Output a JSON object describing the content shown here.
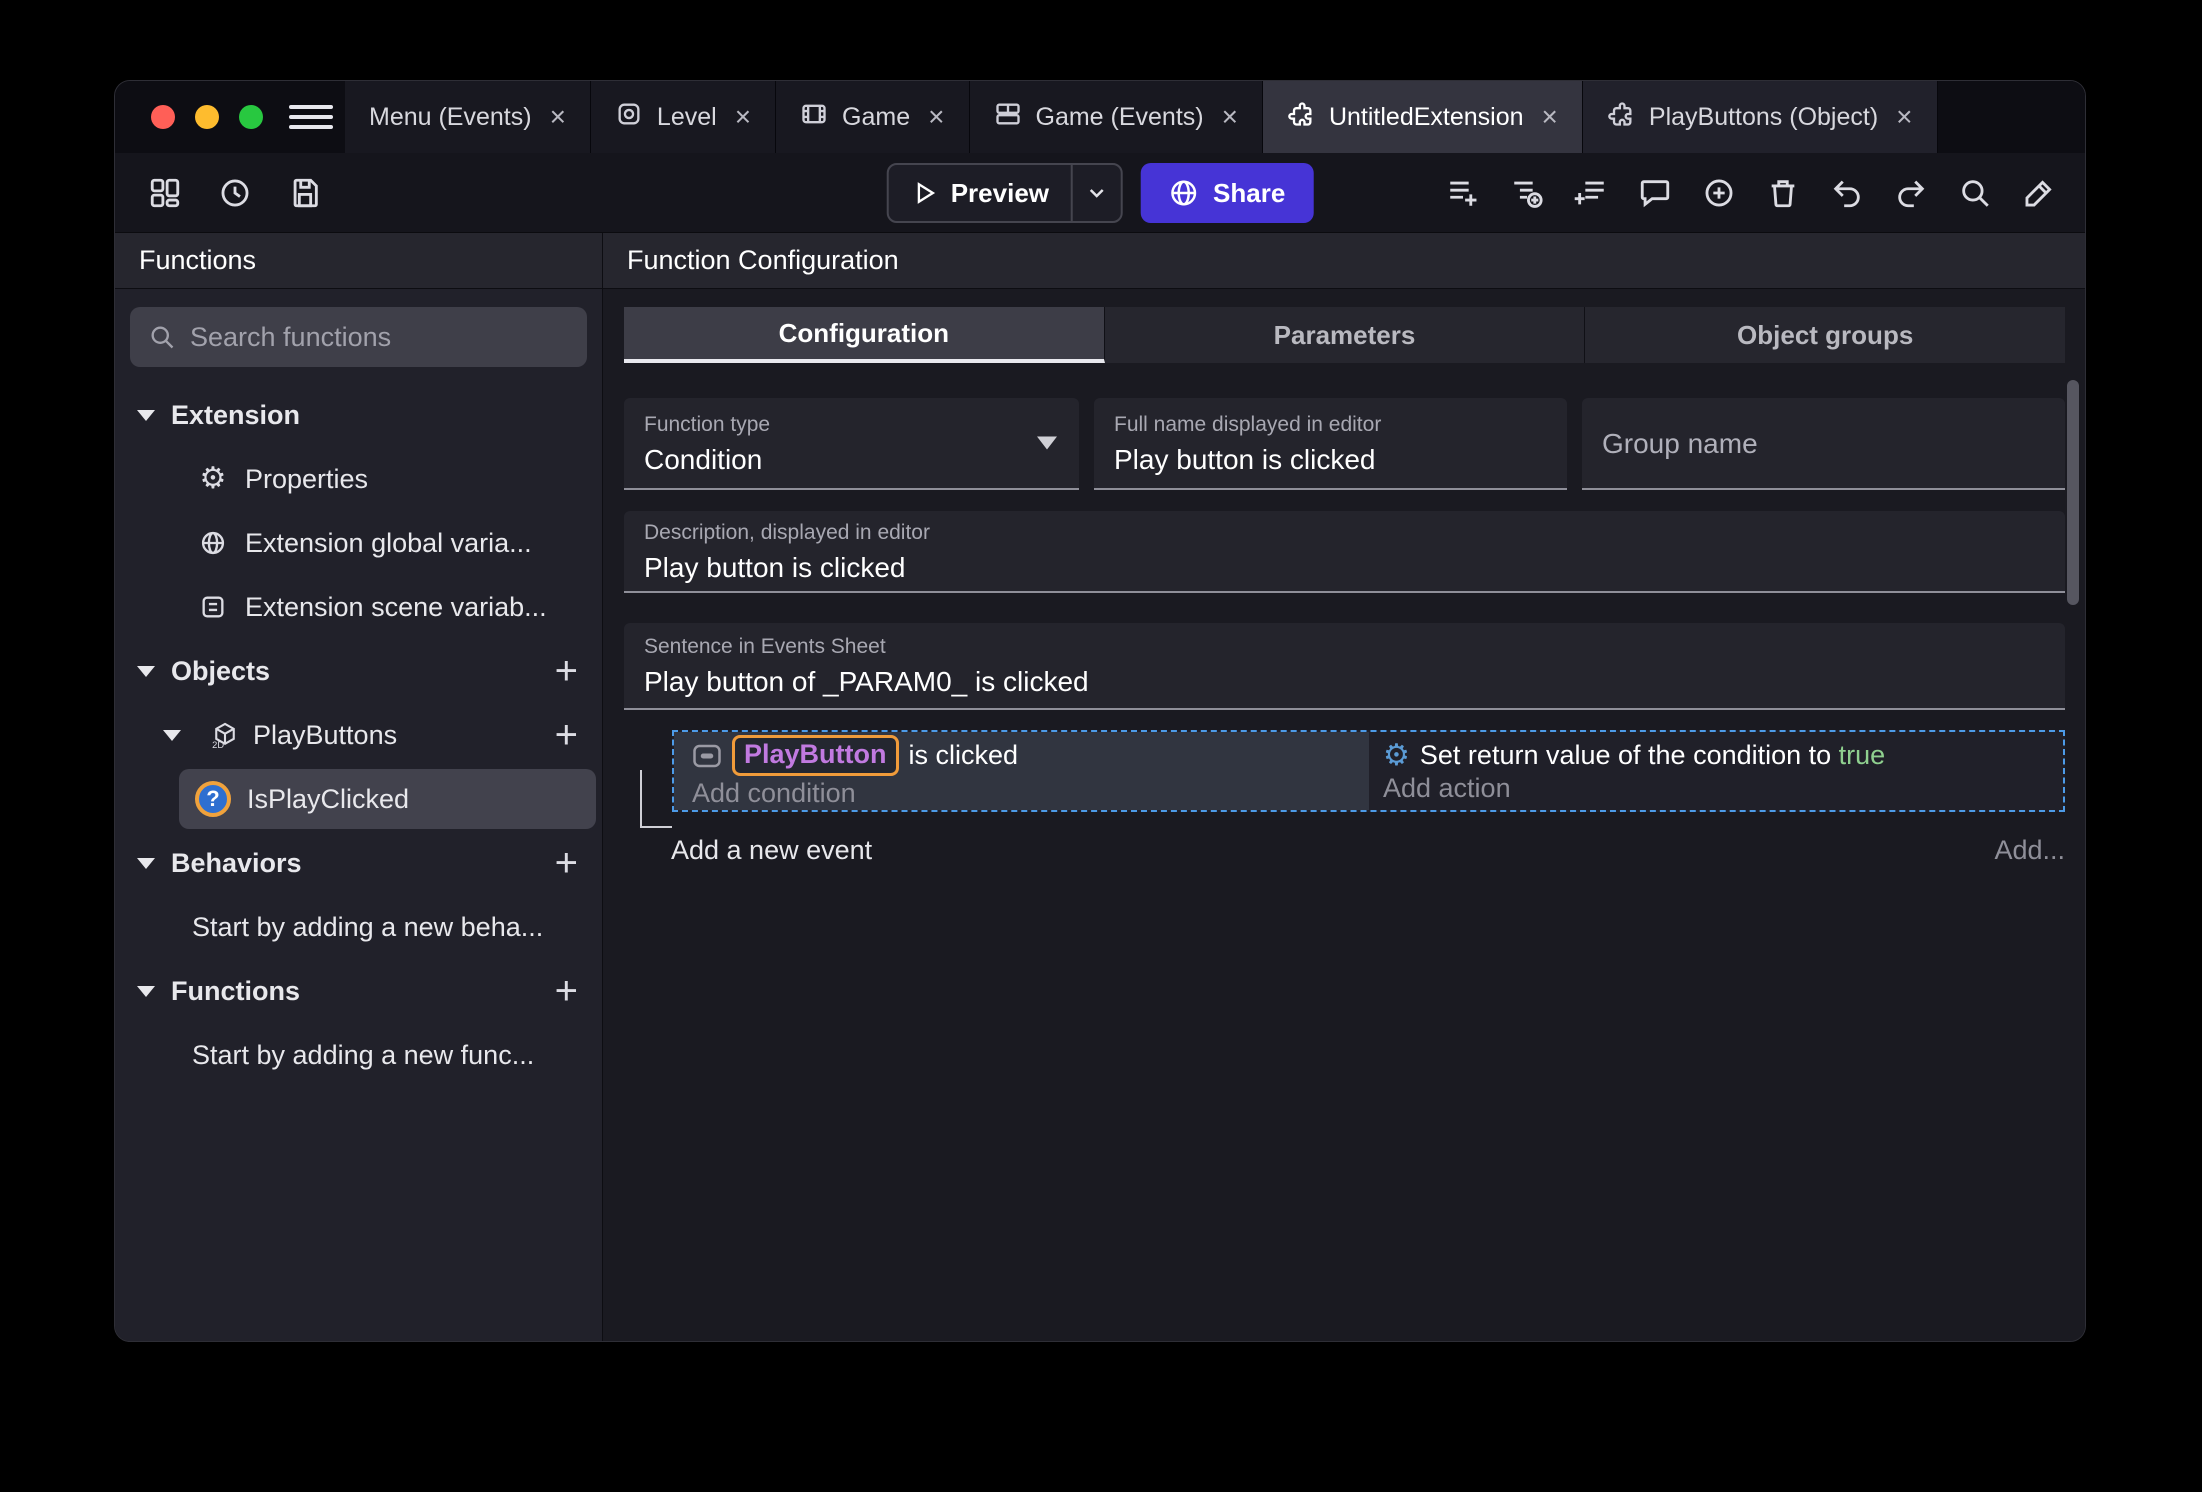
{
  "close_glyph": "×",
  "plus_glyph": "+",
  "icons": {
    "gear": "⚙",
    "question": "?"
  },
  "colors": {
    "accent_purple": "#4634d6",
    "selection_blue": "#4d9be8",
    "chip_text": "#c17ae0",
    "chip_border": "#f09b3a",
    "true_green": "#8fd08f",
    "traffic_close": "#ff5f57",
    "traffic_minimize": "#febc2e",
    "traffic_zoom": "#28c840"
  },
  "tabs": [
    {
      "label": "Menu (Events)"
    },
    {
      "label": "Level"
    },
    {
      "label": "Game"
    },
    {
      "label": "Game (Events)"
    },
    {
      "label": "UntitledExtension"
    },
    {
      "label": "PlayButtons (Object)"
    }
  ],
  "toolbar": {
    "preview_label": "Preview",
    "share_label": "Share"
  },
  "sidebar": {
    "title": "Functions",
    "search_placeholder": "Search functions",
    "extension_section": {
      "label": "Extension",
      "items": [
        {
          "label": "Properties"
        },
        {
          "label": "Extension global varia..."
        },
        {
          "label": "Extension scene variab..."
        }
      ]
    },
    "objects_section": {
      "label": "Objects",
      "object": "PlayButtons",
      "function": "IsPlayClicked"
    },
    "behaviors_section": {
      "label": "Behaviors",
      "hint": "Start by adding a new beha..."
    },
    "functions_section": {
      "label": "Functions",
      "hint": "Start by adding a new func..."
    }
  },
  "main": {
    "title": "Function Configuration",
    "tabs": [
      {
        "label": "Configuration"
      },
      {
        "label": "Parameters"
      },
      {
        "label": "Object groups"
      }
    ],
    "fields": {
      "function_type": {
        "label": "Function type",
        "value": "Condition"
      },
      "full_name": {
        "label": "Full name displayed in editor",
        "value": "Play button is clicked"
      },
      "group_name": {
        "placeholder": "Group name"
      },
      "description": {
        "label": "Description, displayed in editor",
        "value": "Play button is clicked"
      },
      "sentence": {
        "label": "Sentence in Events Sheet",
        "value": "Play button of _PARAM0_ is clicked"
      }
    },
    "events": {
      "condition_object": "PlayButton",
      "condition_suffix": " is clicked",
      "add_condition": "Add condition",
      "action_prefix": "Set return value of the condition to ",
      "action_value": "true",
      "add_action": "Add action",
      "add_new_event": "Add a new event",
      "add_button": "Add..."
    }
  }
}
